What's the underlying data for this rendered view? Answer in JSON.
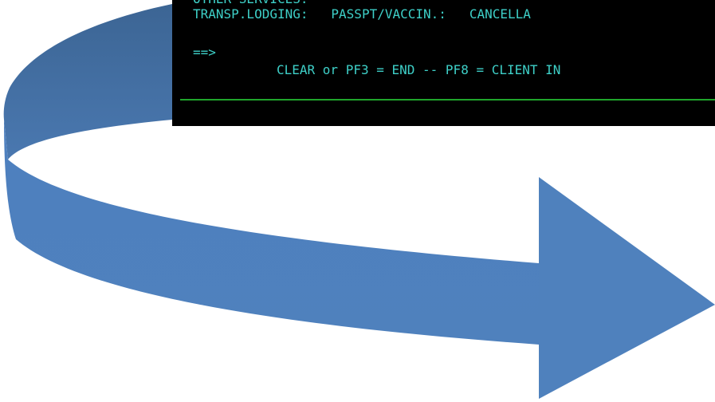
{
  "terminal": {
    "cut_heading": "OTHER SERVICES:",
    "fields": [
      {
        "label": "TRANSP.LODGING:"
      },
      {
        "label": "PASSPT/VACCIN.:"
      },
      {
        "label": "CANCELLA"
      }
    ],
    "prompt": "==>",
    "pf_line": "CLEAR or PF3 = END -- PF8 = CLIENT IN",
    "text_color": "#3ed0c8",
    "divider_color": "#1fa52b",
    "background": "#000000"
  },
  "arrow": {
    "fill_top": "#3f6ea3",
    "fill_bottom": "#4f81bd",
    "description_icon": "curved-arrow-icon"
  }
}
